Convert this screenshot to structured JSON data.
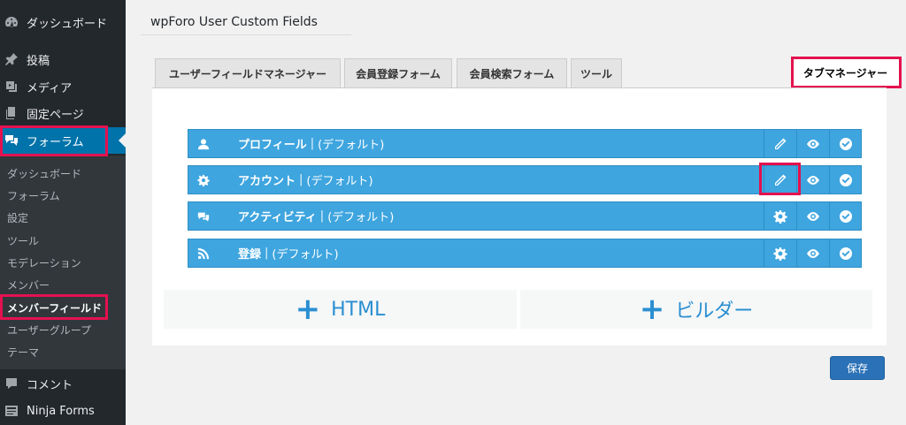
{
  "sidebar": {
    "top": [
      {
        "label": "ダッシュボード",
        "icon": "dashboard-icon"
      },
      {
        "label": "投稿",
        "icon": "pin-icon"
      },
      {
        "label": "メディア",
        "icon": "media-icon"
      },
      {
        "label": "固定ページ",
        "icon": "page-icon"
      },
      {
        "label": "フォーラム",
        "icon": "forum-icon",
        "current": true
      }
    ],
    "submenu": [
      {
        "label": "ダッシュボード"
      },
      {
        "label": "フォーラム"
      },
      {
        "label": "設定"
      },
      {
        "label": "ツール"
      },
      {
        "label": "モデレーション"
      },
      {
        "label": "メンバー"
      },
      {
        "label": "メンバーフィールド",
        "current": true
      },
      {
        "label": "ユーザーグループ"
      },
      {
        "label": "テーマ"
      }
    ],
    "bottom": [
      {
        "label": "コメント",
        "icon": "comment-icon"
      },
      {
        "label": "Ninja Forms",
        "icon": "forms-icon"
      }
    ]
  },
  "page": {
    "title": "wpForo User Custom Fields"
  },
  "tabs": [
    {
      "label": "ユーザーフィールドマネージャー"
    },
    {
      "label": "会員登録フォーム"
    },
    {
      "label": "会員検索フォーム"
    },
    {
      "label": "ツール"
    },
    {
      "label": "タブマネージャー",
      "active": true
    }
  ],
  "rows": [
    {
      "title": "プロフィール",
      "suffix": "(デフォルト)",
      "icon": "user-icon",
      "first_action": "pencil-icon"
    },
    {
      "title": "アカウント",
      "suffix": "(デフォルト)",
      "icon": "gear-icon",
      "first_action": "pencil-icon"
    },
    {
      "title": "アクティビティ",
      "suffix": "(デフォルト)",
      "icon": "chat-icon",
      "first_action": "gear-icon"
    },
    {
      "title": "登録",
      "suffix": "(デフォルト)",
      "icon": "rss-icon",
      "first_action": "gear-icon"
    }
  ],
  "add_buttons": {
    "html": "HTML",
    "builder": "ビルダー",
    "plus": "+"
  },
  "save_label": "保存",
  "colors": {
    "accent": "#3ea5df",
    "highlight": "#e4114f",
    "sidebar": "#23282d",
    "wp_blue": "#0073aa"
  }
}
